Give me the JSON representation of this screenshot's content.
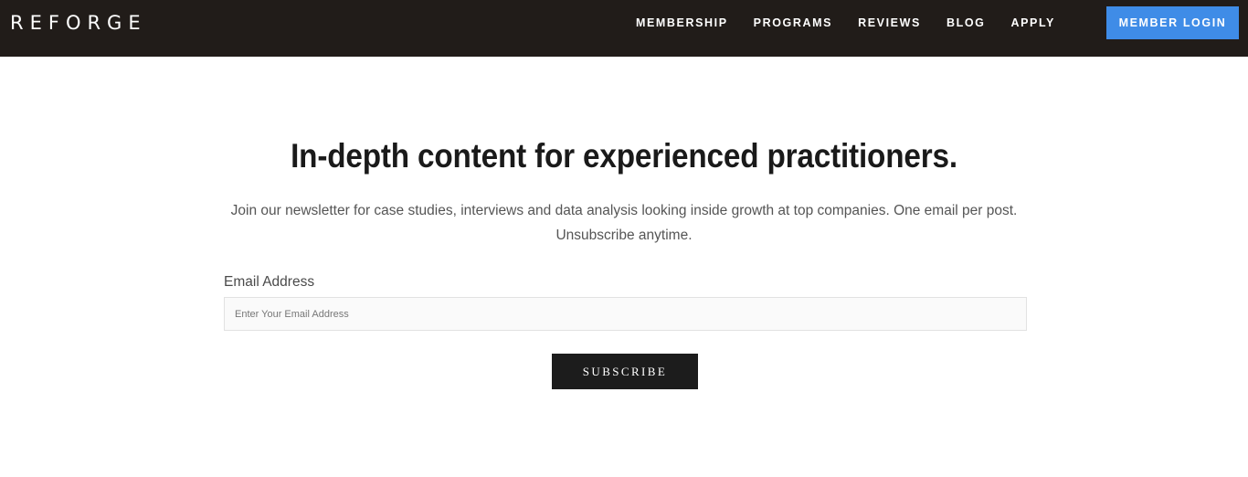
{
  "header": {
    "logo": "REFORGE",
    "nav": [
      {
        "label": "MEMBERSHIP"
      },
      {
        "label": "PROGRAMS"
      },
      {
        "label": "REVIEWS"
      },
      {
        "label": "BLOG"
      },
      {
        "label": "APPLY"
      }
    ],
    "login_label": "MEMBER LOGIN"
  },
  "main": {
    "headline": "In-depth content for experienced practitioners.",
    "subtext": "Join our newsletter for case studies, interviews and data analysis looking inside growth at top companies. One email per post. Unsubscribe anytime.",
    "email_label": "Email Address",
    "email_placeholder": "Enter Your Email Address",
    "email_value": "",
    "subscribe_label": "SUBSCRIBE"
  },
  "colors": {
    "topbar": "#211c19",
    "accent": "#3f8ce7",
    "button_dark": "#1c1c1c"
  }
}
